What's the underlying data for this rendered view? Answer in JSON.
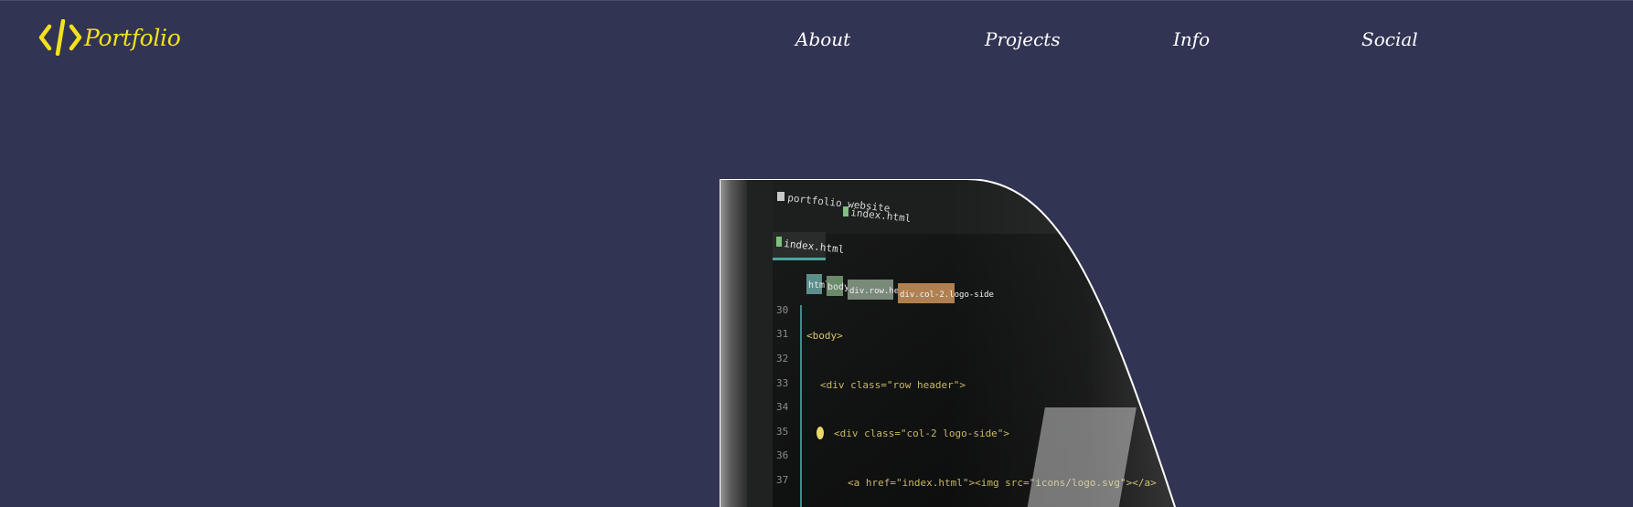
{
  "header": {
    "logo_text": "Portfolio",
    "logo_icon": "code-brackets-icon",
    "accent_color": "#f2e21c"
  },
  "nav": {
    "items": [
      {
        "label": "About"
      },
      {
        "label": "Projects"
      },
      {
        "label": "Info"
      },
      {
        "label": "Social"
      }
    ]
  },
  "hero": {
    "image_description_icon": "code-editor-photo",
    "editor": {
      "folder": "portfolio website",
      "file_tab_top": "index.html",
      "active_tab": "index.html",
      "breadcrumbs": [
        "html",
        "body",
        "div.row.header",
        "div.col-2.logo-side"
      ],
      "lines": [
        {
          "num": "30",
          "code": ""
        },
        {
          "num": "31",
          "code": "<body>"
        },
        {
          "num": "32",
          "code": ""
        },
        {
          "num": "33",
          "code": "<div class=\"row header\">"
        },
        {
          "num": "34",
          "code": ""
        },
        {
          "num": "35",
          "code": "<div class=\"col-2 logo-side\">"
        },
        {
          "num": "36",
          "code": ""
        },
        {
          "num": "37",
          "code": "<a href=\"index.html\"><img src=\"icons/logo.svg\"></a>"
        }
      ]
    }
  },
  "colors": {
    "background": "#313453",
    "nav_text": "#ffffff"
  }
}
